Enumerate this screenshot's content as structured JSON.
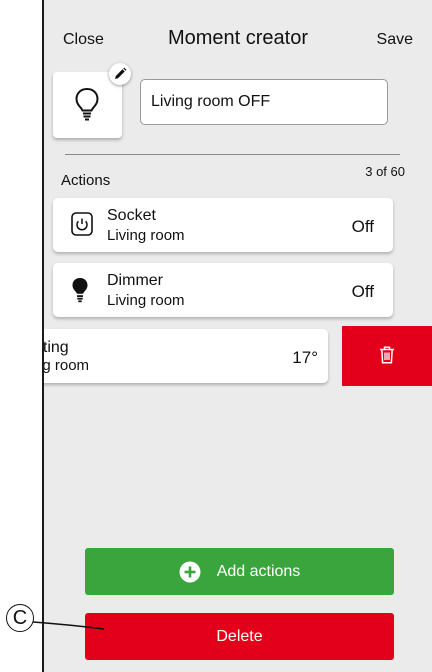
{
  "header": {
    "close_label": "Close",
    "title": "Moment creator",
    "save_label": "Save"
  },
  "moment": {
    "icon": "lightbulb-outline-icon",
    "edit_icon": "pencil-icon",
    "name_value": "Living room OFF"
  },
  "actions": {
    "label": "Actions",
    "count": "3 of 60",
    "items": [
      {
        "icon": "socket-power-icon",
        "title": "Socket",
        "room": "Living room",
        "value": "Off"
      },
      {
        "icon": "lightbulb-filled-icon",
        "title": "Dimmer",
        "room": "Living room",
        "value": "Off"
      },
      {
        "title": "ating",
        "room": "ng room",
        "value": "17°",
        "swiped": true
      }
    ],
    "swipe_delete_icon": "trash-icon"
  },
  "buttons": {
    "add_label": "Add actions",
    "add_icon": "plus-circle-icon",
    "delete_label": "Delete"
  },
  "callout": {
    "label": "C"
  },
  "colors": {
    "background": "#ebebeb",
    "add_green": "#3aa53c",
    "delete_red": "#e2001a"
  }
}
